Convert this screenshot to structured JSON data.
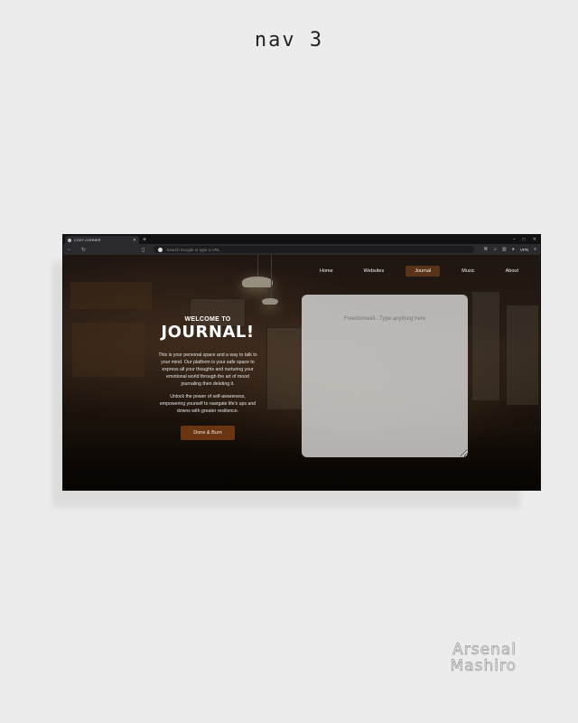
{
  "page": {
    "title": "nav 3",
    "signature_line1": "Arsenal",
    "signature_line2": "Mashiro"
  },
  "browser": {
    "tab_title": "COZY CORNER",
    "new_tab": "+",
    "address_placeholder": "Search Google or type a URL",
    "vpn_label": "VPN",
    "window_controls": [
      "–",
      "□",
      "✕"
    ]
  },
  "nav": {
    "items": [
      {
        "label": "Home",
        "active": false
      },
      {
        "label": "Websites",
        "active": false
      },
      {
        "label": "Journal",
        "active": true
      },
      {
        "label": "Music",
        "active": false
      },
      {
        "label": "About",
        "active": false
      }
    ]
  },
  "hero": {
    "kicker": "WELCOME TO",
    "title": "JOURNAL!",
    "paragraph1": "This is your personal space and a way to talk to your mind. Our platform is your safe space to express all your thoughts and nurturing your emotional world through the art of mood journaling then deleting it.",
    "paragraph2": "Unlock the power of self-awareness, empowering yourself to navigate life's ups and downs with greater resilience.",
    "button_label": "Done & Burn"
  },
  "journal": {
    "placeholder": "Freedomwall...Type anything here"
  },
  "colors": {
    "accent": "#6a3512",
    "nav_active": "#5a3418",
    "page_bg": "#ececec",
    "pane_bg": "#e1e1e1"
  },
  "icons": [
    "back-arrow-icon",
    "reload-icon",
    "bookmark-icon",
    "google-icon",
    "extensions-icon",
    "music-icon",
    "sidebar-icon",
    "profile-icon",
    "menu-icon"
  ]
}
